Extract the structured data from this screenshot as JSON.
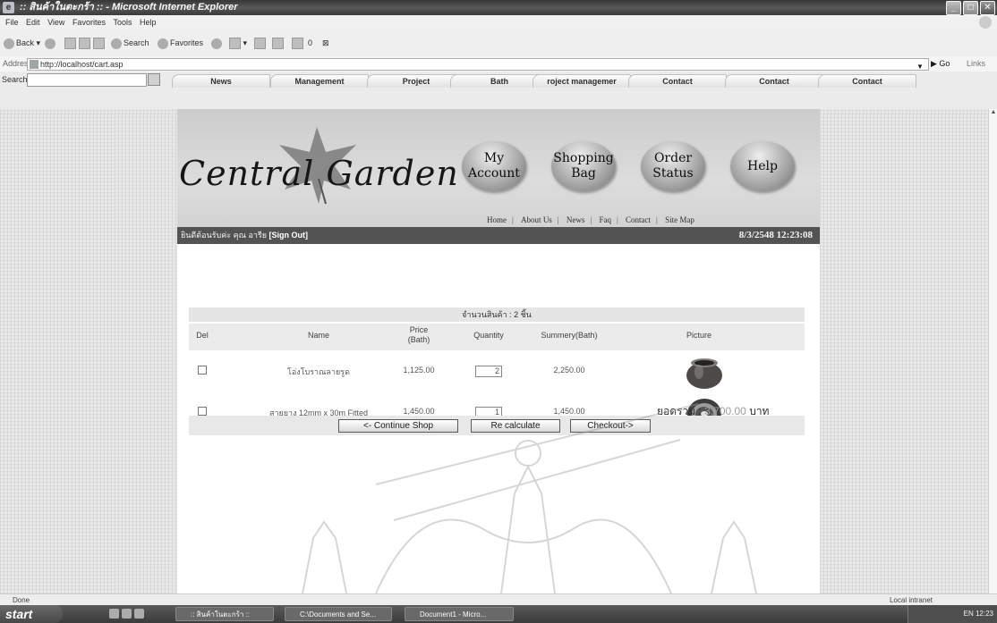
{
  "window": {
    "title": ":: สินค้าในตะกร้า :: - Microsoft Internet Explorer",
    "ie_icon": "internet-explorer-icon"
  },
  "menu": [
    "File",
    "Edit",
    "View",
    "Favorites",
    "Tools",
    "Help"
  ],
  "toolbar": {
    "back": "Back",
    "search": "Search",
    "favorites": "Favorites"
  },
  "address": {
    "label": "Address",
    "url": "http://localhost/cart.asp",
    "go": "Go",
    "links": "Links"
  },
  "searchbar": {
    "label": "Search"
  },
  "tabs": [
    "News",
    "Management",
    "Project",
    "Bath",
    "roject managemer",
    "Contact",
    "Contact",
    "Contact"
  ],
  "site": {
    "logo": "Central Garden",
    "buttons": [
      {
        "line1": "My",
        "line2": "Account"
      },
      {
        "line1": "Shopping",
        "line2": "Bag"
      },
      {
        "line1": "Order",
        "line2": "Status"
      },
      {
        "line1": "Help",
        "line2": ""
      }
    ],
    "links": [
      "Home",
      "About Us",
      "News",
      "Faq",
      "Contact",
      "Site Map"
    ],
    "user_prefix": "ยินดีต้อนรับค่ะ คุณ อารีย",
    "signout": "[Sign Out]",
    "datetime": "8/3/2548 12:23:08"
  },
  "cart": {
    "count_text": "จำนวนสินค้า : 2 ชิ้น",
    "headers": {
      "del": "Del",
      "name": "Name",
      "price_line1": "Price",
      "price_line2": "(Bath)",
      "qty": "Quantity",
      "sum": "Summery(Bath)",
      "pic": "Picture"
    },
    "items": [
      {
        "name": "โอ่งโบราณลายรูด",
        "price": "1,125.00",
        "qty": "2",
        "sum": "2,250.00",
        "picture": "jar-image"
      },
      {
        "name": "สายยาง 12mm x 30m Fitted",
        "price": "1,450.00",
        "qty": "1",
        "sum": "1,450.00",
        "picture": "hose-reel-image"
      }
    ],
    "total_label": "ยอดรวม :",
    "total_value": "3,700.00",
    "total_unit": "บาท",
    "buttons": {
      "continue": "<- Continue Shop",
      "recalc": "Re calculate",
      "checkout": "Checkout->"
    }
  },
  "status": {
    "left": "Done",
    "zone": "Local intranet"
  },
  "taskbar": {
    "start": "start",
    "items": [
      ":: สินค้าในตะกร้า ::",
      "C:\\Documents and Se...",
      "Document1 - Micro..."
    ],
    "tray": "EN 12:23"
  }
}
